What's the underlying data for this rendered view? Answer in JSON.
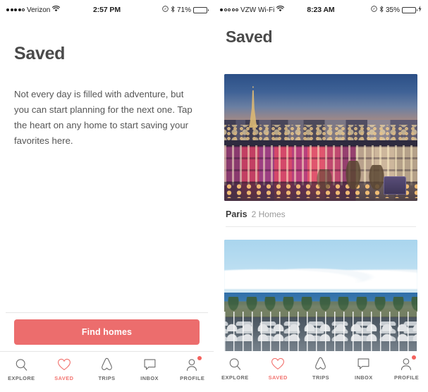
{
  "app": {
    "name": "Airbnb",
    "accent_color": "#ec6d6d",
    "active_tab_color": "#f2736f"
  },
  "screens": [
    {
      "id": "saved-empty",
      "status_bar": {
        "signal_dots": [
          true,
          true,
          true,
          true,
          false
        ],
        "carrier": "Verizon",
        "wifi_icon": "wifi-icon",
        "time": "2:57 PM",
        "location_icon": "location-arrow-icon",
        "bluetooth_icon": "bluetooth-icon",
        "battery_percent": "71%",
        "battery_level": 71,
        "battery_charging": false,
        "battery_color": "#2b2b2b"
      },
      "title": "Saved",
      "empty_state": {
        "message": "Not every day is filled with adventure, but you can start planning for the next one. Tap the heart on any home to start saving your favorites here."
      },
      "cta": {
        "label": "Find homes"
      }
    },
    {
      "id": "saved-list",
      "status_bar": {
        "signal_dots": [
          true,
          false,
          false,
          false,
          false
        ],
        "carrier": "VZW Wi-Fi",
        "wifi_icon": "wifi-icon",
        "time": "8:23 AM",
        "location_icon": "location-arrow-icon",
        "bluetooth_icon": "bluetooth-icon",
        "battery_percent": "35%",
        "battery_level": 35,
        "battery_charging": true,
        "charging_icon": "lightning-bolt-icon",
        "battery_color": "#5ed35e"
      },
      "title": "Saved",
      "saved_cards": [
        {
          "city": "Paris",
          "homes": "2 Homes",
          "photo_name": "paris-dusk-cityscape-photo",
          "photo_alt": "Paris skyline at dusk with Eiffel Tower and illuminated Haussmann buildings"
        },
        {
          "city": "",
          "homes": "",
          "photo_name": "marina-harbor-photo",
          "photo_alt": "Marina with sailboats, palm trees and ocean horizon"
        }
      ]
    }
  ],
  "tab_bar": {
    "items": [
      {
        "label": "EXPLORE",
        "icon": "search-icon",
        "active": false,
        "badge": false
      },
      {
        "label": "SAVED",
        "icon": "heart-icon",
        "active": true,
        "badge": false
      },
      {
        "label": "TRIPS",
        "icon": "airbnb-belo-icon",
        "active": false,
        "badge": false
      },
      {
        "label": "INBOX",
        "icon": "speech-bubble-icon",
        "active": false,
        "badge": false
      },
      {
        "label": "PROFILE",
        "icon": "person-icon",
        "active": false,
        "badge": true
      }
    ]
  }
}
